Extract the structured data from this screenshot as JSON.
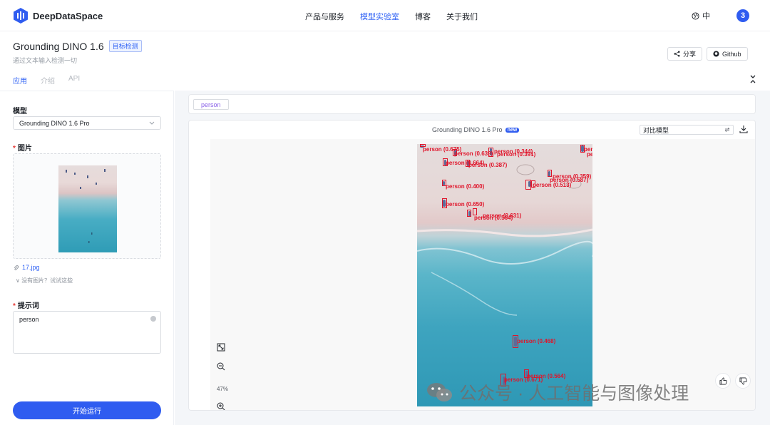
{
  "header": {
    "brand": "DeepDataSpace",
    "nav": [
      {
        "label": "产品与服务",
        "active": false
      },
      {
        "label": "模型实验室",
        "active": true
      },
      {
        "label": "博客",
        "active": false
      },
      {
        "label": "关于我们",
        "active": false
      }
    ],
    "language": "中",
    "avatar_text": "3"
  },
  "page": {
    "title": "Grounding DINO 1.6",
    "tag": "目标检测",
    "subtitle": "通过文本输入检测一切",
    "share_label": "分享",
    "github_label": "Github",
    "tabs": [
      {
        "label": "应用",
        "active": true
      },
      {
        "label": "介绍",
        "active": false
      },
      {
        "label": "API",
        "active": false
      }
    ]
  },
  "form": {
    "model_label": "模型",
    "model_value": "Grounding DINO 1.6 Pro",
    "image_label": "图片",
    "file_name": "17.jpg",
    "no_image_hint": "没有图片？试试这些",
    "prompt_label": "提示词",
    "prompt_value": "person",
    "run_label": "开始运行"
  },
  "result": {
    "prompt_chip": "person",
    "model_name": "Grounding DINO 1.6 Pro",
    "new_badge": "new",
    "compare_placeholder": "对比模型",
    "zoom": "47%",
    "detections": [
      {
        "label": "person (0.675)"
      },
      {
        "label": "person (0.639)"
      },
      {
        "label": "person (0.344)"
      },
      {
        "label": "person (0.391)"
      },
      {
        "label": "person (0.649)"
      },
      {
        "label": "person (0.629)"
      },
      {
        "label": "person (0.664)"
      },
      {
        "label": "person (0.387)"
      },
      {
        "label": "person (0.359)"
      },
      {
        "label": "person (0.587)"
      },
      {
        "label": "person (0.513)"
      },
      {
        "label": "person (0.400)"
      },
      {
        "label": "person (0.650)"
      },
      {
        "label": "person (0.631)"
      },
      {
        "label": "person (0.564)"
      },
      {
        "label": "person (0.468)"
      },
      {
        "label": "person (0.564)"
      },
      {
        "label": "person (0.671)"
      }
    ]
  },
  "watermark": "公众号 · 人工智能与图像处理",
  "colors": {
    "accent": "#2f5cf0",
    "detection": "#e0142a"
  }
}
